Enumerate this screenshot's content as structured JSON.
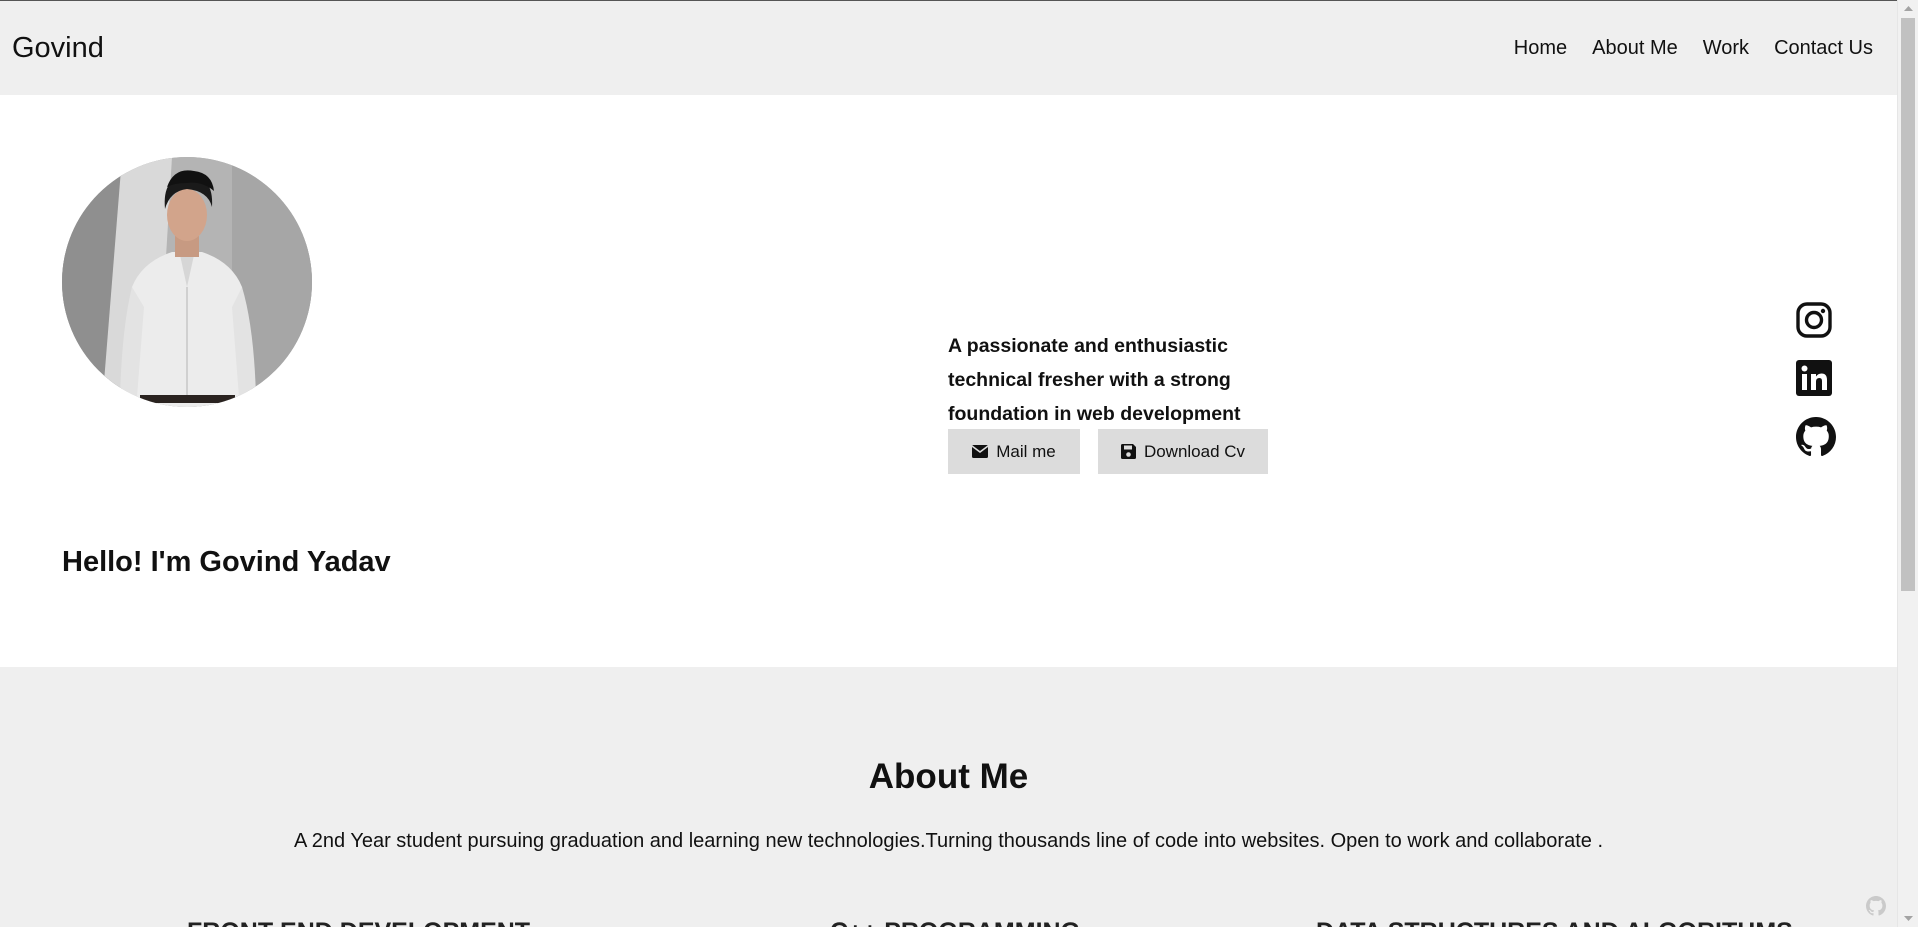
{
  "navbar": {
    "brand": "Govind",
    "links": [
      "Home",
      "About Me",
      "Work",
      "Contact Us"
    ]
  },
  "hero": {
    "tagline": "A passionate and enthusiastic technical fresher with a strong foundation in web development",
    "mail_button": "Mail me",
    "cv_button": "Download Cv",
    "greeting": "Hello! I'm Govind Yadav",
    "socials": [
      "instagram-icon",
      "linkedin-icon",
      "github-icon"
    ]
  },
  "about": {
    "title": "About Me",
    "text": "A 2nd Year student pursuing graduation and learning new technologies.Turning thousands line of code into websites. Open to work and collaborate .",
    "skills": [
      "FRONT END DEVELOPMENT",
      "C++ PROGRAMMING",
      "DATA STRUCTURES AND ALGORITHMS"
    ]
  },
  "colors": {
    "navbar_bg": "#efefef",
    "button_bg": "#dcdcdc",
    "section_bg": "#efefef",
    "text": "#111111"
  }
}
